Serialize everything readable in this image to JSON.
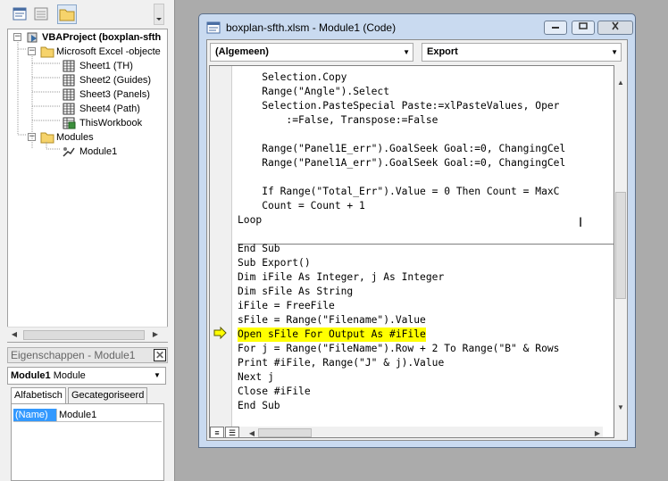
{
  "project_explorer": {
    "tree": [
      {
        "label": "VBAProject (boxplan-sfth",
        "bold": true,
        "expander": "−",
        "icon": "vba-project-icon"
      },
      {
        "label": "Microsoft Excel -objecte",
        "bold": false,
        "expander": "−",
        "icon": "folder-icon"
      },
      {
        "label": "Sheet1 (TH)",
        "icon": "sheet-icon"
      },
      {
        "label": "Sheet2 (Guides)",
        "icon": "sheet-icon"
      },
      {
        "label": "Sheet3 (Panels)",
        "icon": "sheet-icon"
      },
      {
        "label": "Sheet4 (Path)",
        "icon": "sheet-icon"
      },
      {
        "label": "ThisWorkbook",
        "icon": "workbook-icon"
      },
      {
        "label": "Modules",
        "expander": "−",
        "icon": "folder-icon"
      },
      {
        "label": "Module1",
        "icon": "module-icon"
      }
    ]
  },
  "properties": {
    "title": "Eigenschappen - Module1",
    "object_name": "Module1",
    "object_type": "Module",
    "tabs": [
      "Alfabetisch",
      "Gecategoriseerd"
    ],
    "rows": [
      {
        "name": "(Name)",
        "value": "Module1"
      }
    ]
  },
  "code_window": {
    "title": "boxplan-sfth.xlsm - Module1 (Code)",
    "object_combo": "(Algemeen)",
    "procedure_combo": "Export",
    "code_lines": [
      "    Selection.Copy",
      "    Range(\"Angle\").Select",
      "    Selection.PasteSpecial Paste:=xlPasteValues, Oper",
      "        :=False, Transpose:=False",
      "",
      "    Range(\"Panel1E_err\").GoalSeek Goal:=0, ChangingCel",
      "    Range(\"Panel1A_err\").GoalSeek Goal:=0, ChangingCel",
      "",
      "    If Range(\"Total_Err\").Value = 0 Then Count = MaxC",
      "    Count = Count + 1",
      "Loop",
      "",
      "End Sub",
      "Sub Export()",
      "Dim iFile As Integer, j As Integer",
      "Dim sFile As String",
      "iFile = FreeFile",
      "sFile = Range(\"Filename\").Value",
      "Open sFile For Output As #iFile",
      "For j = Range(\"FileName\").Row + 2 To Range(\"B\" & Rows",
      "Print #iFile, Range(\"J\" & j).Value",
      "Next j",
      "Close #iFile",
      "End Sub"
    ],
    "highlighted_line": 18,
    "highlight_color": "#ffff00"
  }
}
